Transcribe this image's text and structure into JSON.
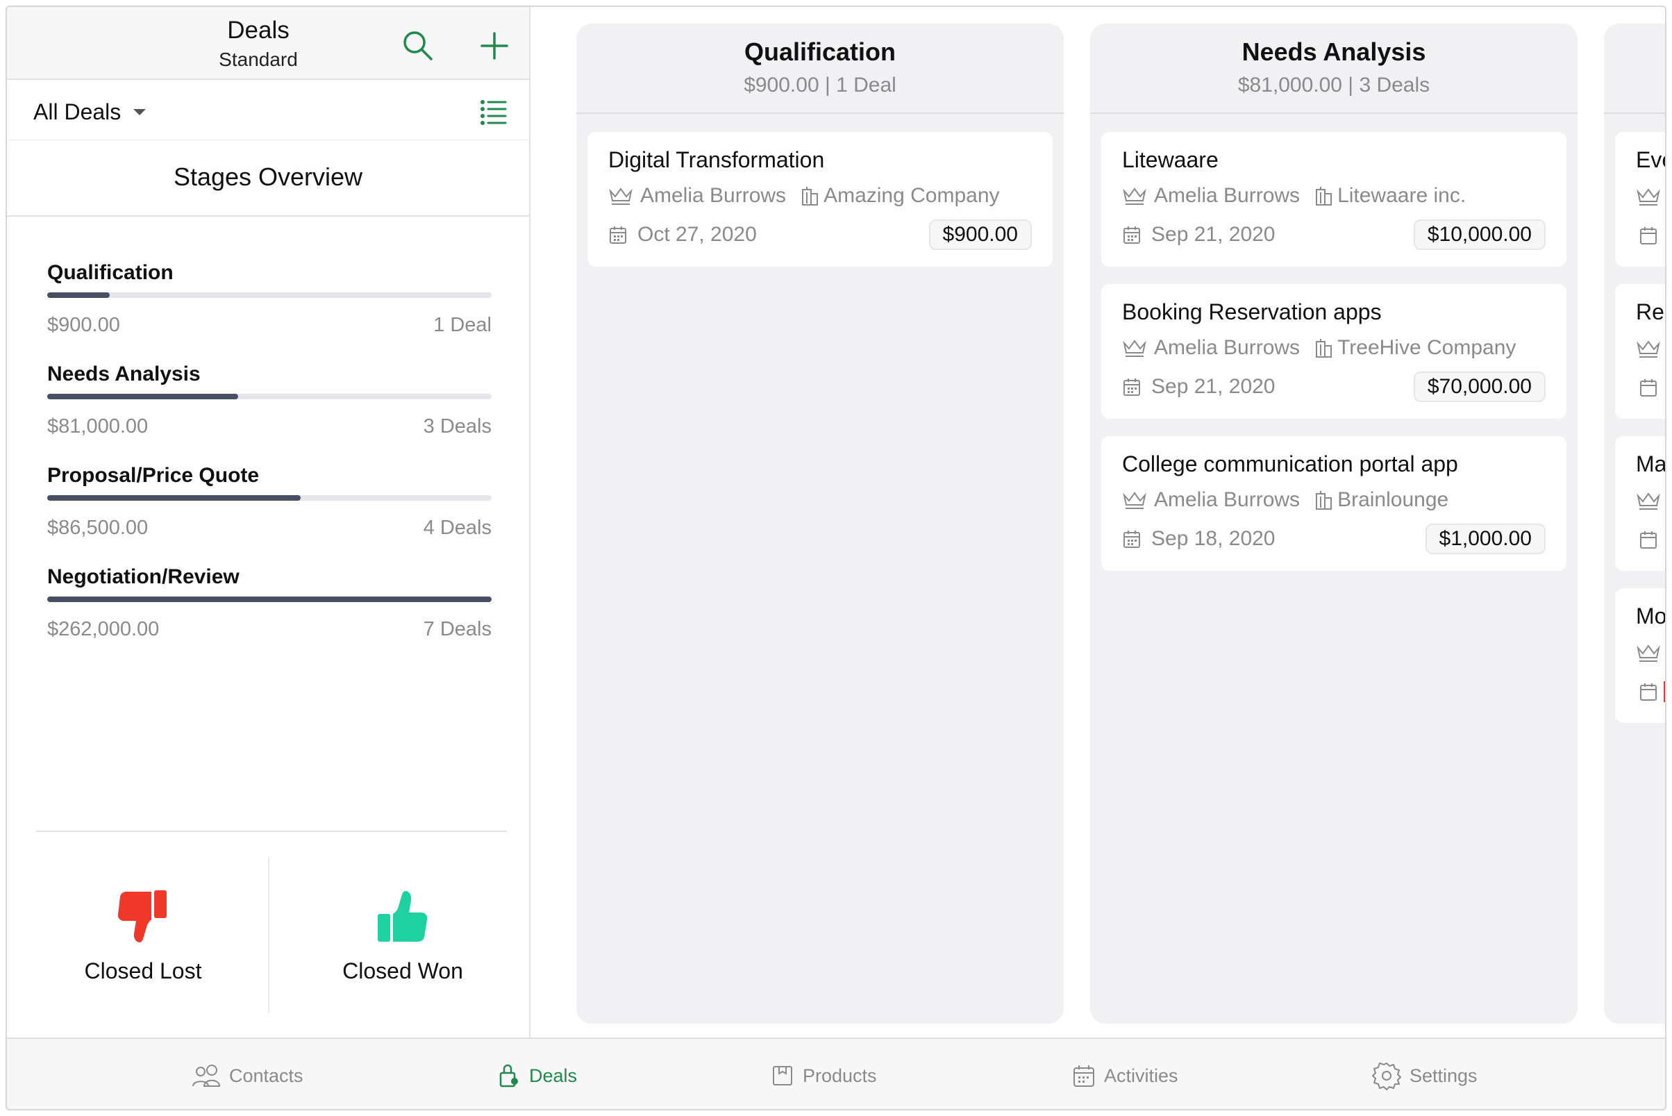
{
  "header": {
    "title": "Deals",
    "subtitle": "Standard"
  },
  "filter": {
    "label": "All Deals"
  },
  "overview": {
    "title": "Stages Overview",
    "stages": [
      {
        "name": "Qualification",
        "amount": "$900.00",
        "count": "1 Deal",
        "progress": 0.14
      },
      {
        "name": "Needs Analysis",
        "amount": "$81,000.00",
        "count": "3 Deals",
        "progress": 0.43
      },
      {
        "name": "Proposal/Price Quote",
        "amount": "$86,500.00",
        "count": "4 Deals",
        "progress": 0.57
      },
      {
        "name": "Negotiation/Review",
        "amount": "$262,000.00",
        "count": "7 Deals",
        "progress": 1.0
      }
    ],
    "closed_lost": "Closed Lost",
    "closed_won": "Closed Won"
  },
  "board": {
    "columns": [
      {
        "title": "Qualification",
        "summary": "$900.00 | 1 Deal",
        "cards": [
          {
            "title": "Digital Transformation",
            "owner": "Amelia Burrows",
            "company": "Amazing Company",
            "date": "Oct 27, 2020",
            "amount": "$900.00"
          }
        ]
      },
      {
        "title": "Needs Analysis",
        "summary": "$81,000.00 | 3 Deals",
        "cards": [
          {
            "title": "Litewaare",
            "owner": "Amelia Burrows",
            "company": "Litewaare inc.",
            "date": "Sep 21, 2020",
            "amount": "$10,000.00"
          },
          {
            "title": "Booking Reservation apps",
            "owner": "Amelia Burrows",
            "company": "TreeHive Company",
            "date": "Sep 21, 2020",
            "amount": "$70,000.00"
          },
          {
            "title": "College communication portal app",
            "owner": "Amelia Burrows",
            "company": "Brainlounge",
            "date": "Sep 18, 2020",
            "amount": "$1,000.00"
          }
        ]
      }
    ],
    "partial_column": {
      "cards": [
        {
          "title": "Eve"
        },
        {
          "title": "Res"
        },
        {
          "title": "Mac"
        },
        {
          "title": "Mol"
        }
      ]
    }
  },
  "tabs": [
    {
      "label": "Contacts",
      "icon": "contacts-icon",
      "active": false
    },
    {
      "label": "Deals",
      "icon": "deals-icon",
      "active": true
    },
    {
      "label": "Products",
      "icon": "products-icon",
      "active": false
    },
    {
      "label": "Activities",
      "icon": "activities-icon",
      "active": false
    },
    {
      "label": "Settings",
      "icon": "settings-icon",
      "active": false
    }
  ],
  "colors": {
    "accent_green": "#1f8a4c",
    "closed_lost_red": "#f0392b",
    "closed_won_green": "#1fd1a0",
    "progress_fill": "#475063",
    "overdue_red": "#e53935"
  }
}
